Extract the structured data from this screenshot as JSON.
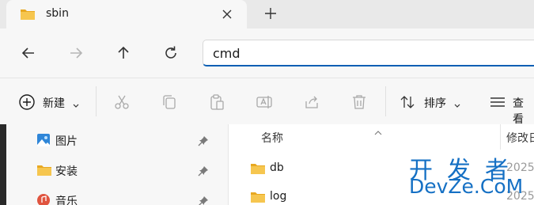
{
  "tab": {
    "title": "sbin"
  },
  "address": {
    "value": "cmd"
  },
  "toolbar": {
    "new_label": "新建",
    "sort_label": "排序",
    "view_label": "查看"
  },
  "nav": {
    "items": [
      {
        "label": "图片",
        "icon": "pictures-icon"
      },
      {
        "label": "安装",
        "icon": "folder-icon"
      },
      {
        "label": "音乐",
        "icon": "music-icon"
      }
    ]
  },
  "columns": {
    "name": "名称",
    "date": "修改日"
  },
  "files": [
    {
      "name": "db",
      "date": "2025"
    },
    {
      "name": "log",
      "date": "2025"
    }
  ],
  "watermark": {
    "line1": "开发者",
    "line2": "DevZe.CoM"
  },
  "colors": {
    "accent": "#0a5fb4",
    "folder": "#f3c34d",
    "watermark": "#1570c4"
  }
}
